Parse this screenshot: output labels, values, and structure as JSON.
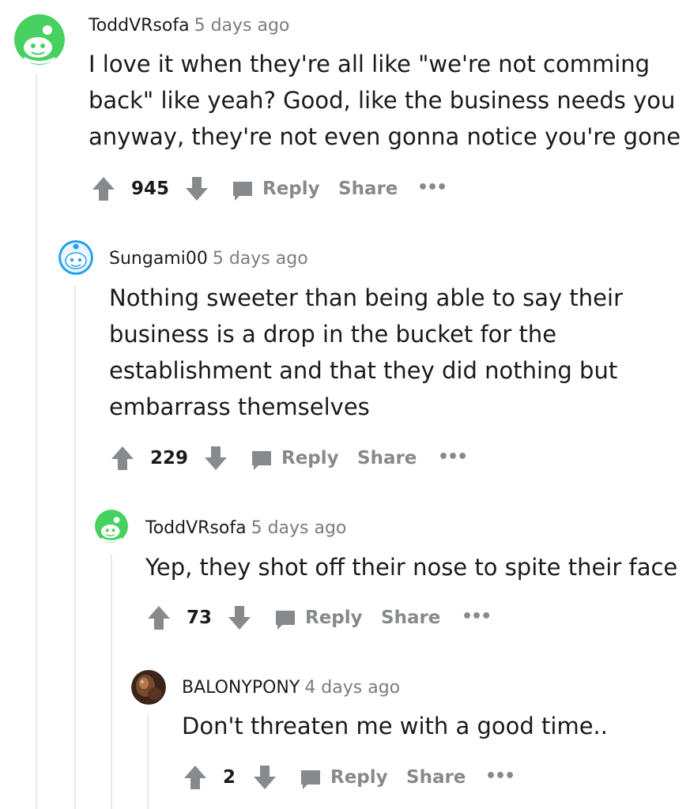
{
  "comments": [
    {
      "username": "ToddVRsofa",
      "time": "5 days ago",
      "body": [
        "I love it when they're all like \"we're not comming",
        "back\" like yeah? Good, like the business needs you",
        "anyway, they're not even gonna notice you're gone"
      ],
      "score": "945",
      "reply_label": "Reply",
      "share_label": "Share",
      "more_label": "•••",
      "avatar_icon": "snoo-green-avatar-icon"
    },
    {
      "username": "Sungami00",
      "time": "5 days ago",
      "body": [
        "Nothing sweeter than being able to say their",
        "business is a drop in the bucket for the",
        "establishment and that they did nothing but",
        "embarrass themselves"
      ],
      "score": "229",
      "reply_label": "Reply",
      "share_label": "Share",
      "more_label": "•••",
      "avatar_icon": "snoo-blue-avatar-icon"
    },
    {
      "username": "ToddVRsofa",
      "time": "5 days ago",
      "body": [
        "Yep, they shot off their nose to spite their face"
      ],
      "score": "73",
      "reply_label": "Reply",
      "share_label": "Share",
      "more_label": "•••",
      "avatar_icon": "snoo-green-avatar-icon"
    },
    {
      "username": "BALONYPONY",
      "time": "4 days ago",
      "body": [
        "Don't threaten me with a good time.."
      ],
      "score": "2",
      "reply_label": "Reply",
      "share_label": "Share",
      "more_label": "•••",
      "avatar_icon": "photo-avatar-icon"
    }
  ],
  "colors": {
    "meta_gray": "#7c7c7c",
    "action_gray": "#878a8c",
    "thread_line": "#e8e8e8",
    "green_avatar": "#46d160",
    "blue_avatar": "#0dd3bb"
  }
}
